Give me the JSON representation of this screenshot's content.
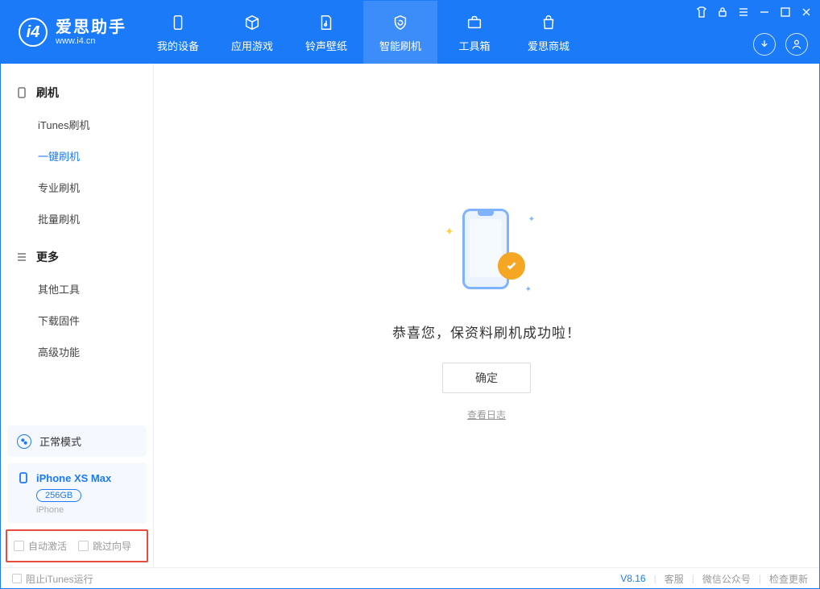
{
  "app": {
    "title": "爱思助手",
    "subtitle": "www.i4.cn"
  },
  "nav": [
    {
      "label": "我的设备"
    },
    {
      "label": "应用游戏"
    },
    {
      "label": "铃声壁纸"
    },
    {
      "label": "智能刷机"
    },
    {
      "label": "工具箱"
    },
    {
      "label": "爱思商城"
    }
  ],
  "sidebar": {
    "group1": {
      "title": "刷机",
      "items": [
        "iTunes刷机",
        "一键刷机",
        "专业刷机",
        "批量刷机"
      ]
    },
    "group2": {
      "title": "更多",
      "items": [
        "其他工具",
        "下载固件",
        "高级功能"
      ]
    }
  },
  "mode": {
    "label": "正常模式"
  },
  "device": {
    "name": "iPhone XS Max",
    "storage": "256GB",
    "type": "iPhone"
  },
  "highlight": {
    "opt1": "自动激活",
    "opt2": "跳过向导"
  },
  "main": {
    "success": "恭喜您，保资料刷机成功啦！",
    "ok": "确定",
    "log": "查看日志"
  },
  "footer": {
    "block_itunes": "阻止iTunes运行",
    "version": "V8.16",
    "service": "客服",
    "wechat": "微信公众号",
    "update": "检查更新"
  }
}
